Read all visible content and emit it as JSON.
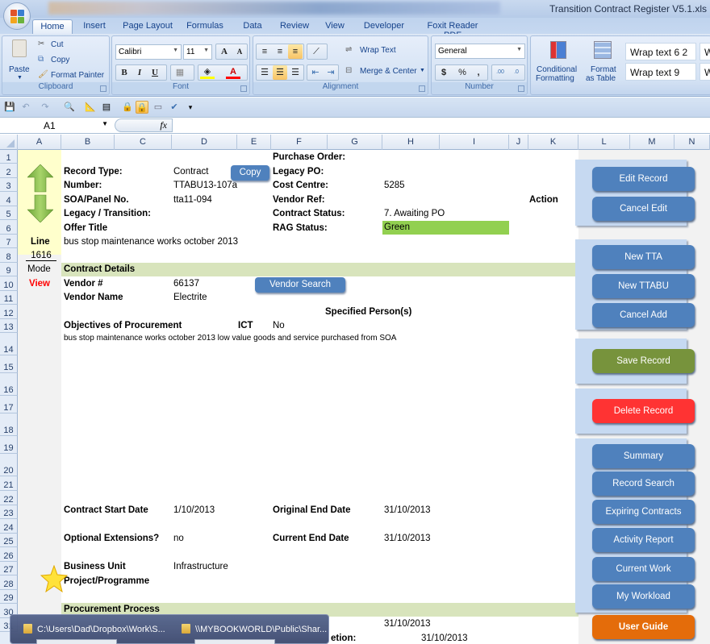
{
  "window": {
    "title": "Transition Contract Register V5.1.xls"
  },
  "ribbon": {
    "tabs": [
      {
        "label": "Home",
        "active": true
      },
      {
        "label": "Insert"
      },
      {
        "label": "Page Layout"
      },
      {
        "label": "Formulas"
      },
      {
        "label": "Data"
      },
      {
        "label": "Review"
      },
      {
        "label": "View"
      },
      {
        "label": "Developer"
      },
      {
        "label": "Foxit Reader PDF"
      }
    ],
    "clipboard": {
      "group_label": "Clipboard",
      "paste": "Paste",
      "cut": "Cut",
      "copy": "Copy",
      "format_painter": "Format Painter"
    },
    "font": {
      "group_label": "Font",
      "font_name": "Calibri",
      "font_size": "11",
      "bold": "B",
      "italic": "I",
      "underline": "U",
      "grow": "A",
      "shrink": "A",
      "font_color": "A"
    },
    "alignment": {
      "group_label": "Alignment",
      "wrap_text": "Wrap Text",
      "merge_center": "Merge & Center"
    },
    "number": {
      "group_label": "Number",
      "format": "General",
      "currency": "$",
      "percent": "%",
      "comma": ",",
      "inc_decimal": ".0→.00",
      "dec_decimal": ".00→.0"
    },
    "styles": {
      "conditional_formatting_1": "Conditional",
      "conditional_formatting_2": "Formatting",
      "format_table_1": "Format",
      "format_table_2": "as Table",
      "cell_styles": [
        "Wrap text 6 2",
        "Wrap text 9",
        "W",
        "W"
      ]
    }
  },
  "formula_bar": {
    "name_box": "A1",
    "fx": "fx",
    "formula": ""
  },
  "columns": [
    "A",
    "B",
    "C",
    "D",
    "E",
    "F",
    "G",
    "H",
    "I",
    "J",
    "K",
    "L",
    "M",
    "N"
  ],
  "rows": [
    "1",
    "2",
    "3",
    "4",
    "5",
    "6",
    "7",
    "8",
    "9",
    "10",
    "11",
    "12",
    "13",
    "14",
    "15",
    "16",
    "17",
    "18",
    "19",
    "20",
    "21",
    "22",
    "23",
    "24",
    "25",
    "26",
    "27",
    "28",
    "29",
    "30",
    "31"
  ],
  "record": {
    "record_type_label": "Record Type:",
    "record_type": "Contract",
    "number_label": "Number:",
    "number": "TTABU13-107a",
    "soa_label": "SOA/Panel No.",
    "soa": "tta11-094",
    "legacy_label": "Legacy / Transition:",
    "offer_title_label": "Offer Title",
    "offer_title": "bus stop maintenance works october 2013",
    "line_label": "Line",
    "line_number": "1616",
    "mode_label": "Mode",
    "mode_value": "View",
    "purchase_order_label": "Purchase Order:",
    "legacy_po_label": "Legacy PO:",
    "cost_centre_label": "Cost Centre:",
    "cost_centre": "5285",
    "vendor_ref_label": "Vendor Ref:",
    "action_label": "Action",
    "contract_status_label": "Contract Status:",
    "contract_status": "7. Awaiting PO",
    "rag_status_label": "RAG Status:",
    "rag_status": "Green",
    "rag_color": "#92d050"
  },
  "contract_details": {
    "section_title": "Contract Details",
    "vendor_no_label": "Vendor #",
    "vendor_no": "66137",
    "vendor_name_label": "Vendor Name",
    "vendor_name": "Electrite",
    "specified_persons_label": "Specified Person(s)",
    "objectives_label": "Objectives of Procurement",
    "ict_label": "ICT",
    "ict_value": "No",
    "objectives_text": "bus stop maintenance works october 2013 low value goods and service purchased from SOA",
    "start_date_label": "Contract Start Date",
    "start_date": "1/10/2013",
    "original_end_label": "Original End Date",
    "original_end": "31/10/2013",
    "optional_ext_label": "Optional Extensions?",
    "optional_ext": "no",
    "current_end_label": "Current End Date",
    "current_end": "31/10/2013",
    "business_unit_label": "Business Unit",
    "business_unit": "Infrastructure",
    "project_label": "Project/Programme"
  },
  "procurement": {
    "section_title": "Procurement Process",
    "row30_value": "31/10/2013",
    "row31_label_fragment": "etion:",
    "row31_value": "31/10/2013"
  },
  "buttons": {
    "copy": "Copy",
    "vendor_search": "Vendor Search",
    "edit_record": "Edit Record",
    "cancel_edit": "Cancel Edit",
    "new_tta": "New TTA",
    "new_ttabu": "New TTABU",
    "cancel_add": "Cancel Add",
    "save_record": "Save Record",
    "delete_record": "Delete Record",
    "summary": "Summary",
    "record_search": "Record Search",
    "expiring_contracts": "Expiring Contracts",
    "activity_report": "Activity Report",
    "current_work": "Current Work",
    "my_workload": "My Workload",
    "user_guide": "User Guide"
  },
  "taskbar_preview": {
    "items": [
      "C:\\Users\\Dad\\Dropbox\\Work\\S...",
      "\\\\MYBOOKWORLD\\Public\\Shar..."
    ]
  }
}
